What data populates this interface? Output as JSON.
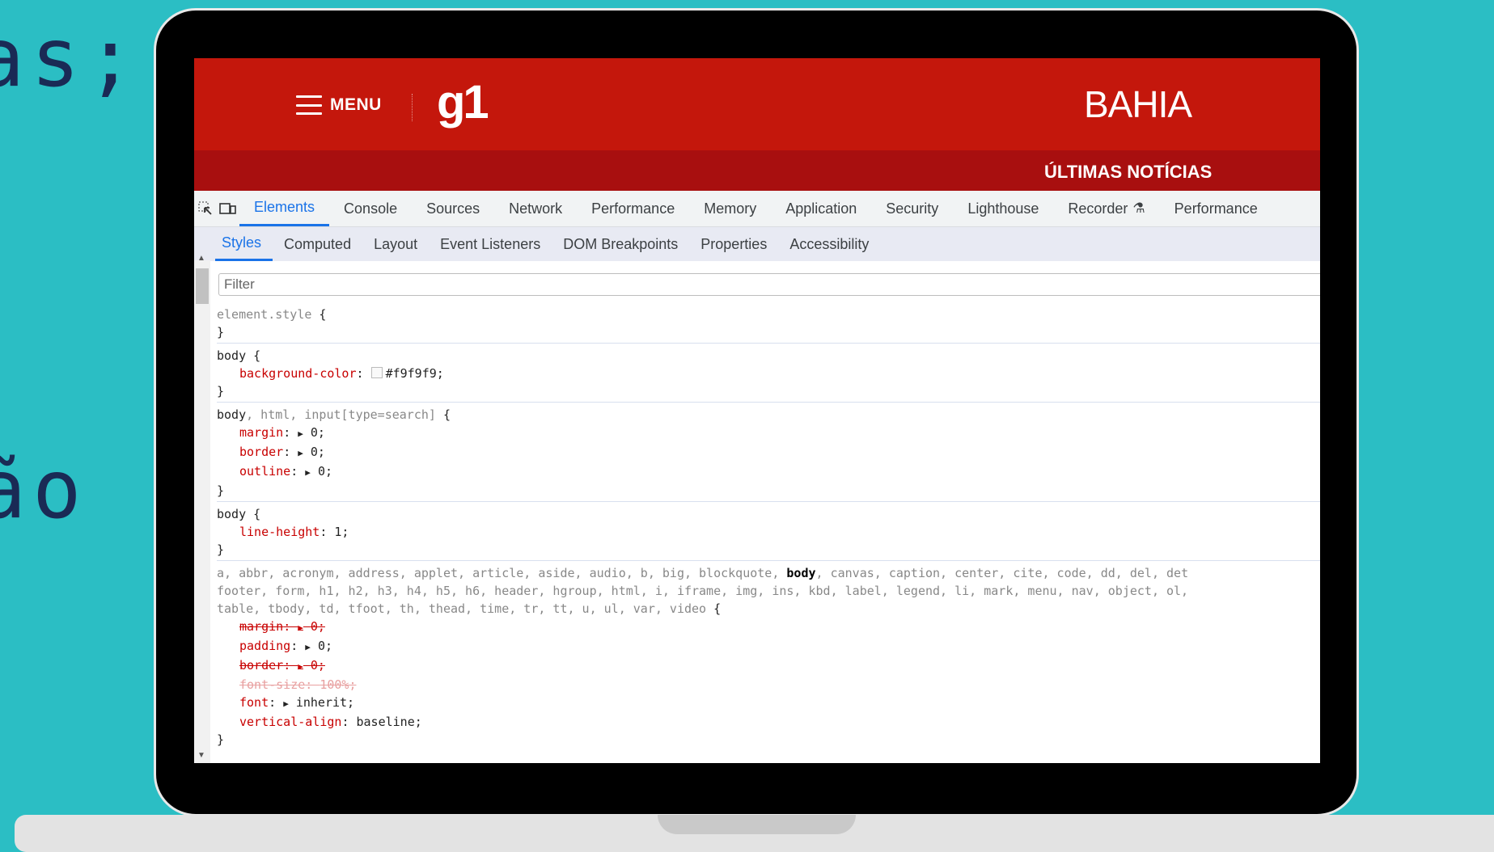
{
  "background": {
    "text_line1": "as;",
    "text_line2": "ão"
  },
  "g1": {
    "menu_label": "MENU",
    "logo": "g1",
    "region": "BAHIA",
    "sub_link": "ÚLTIMAS NOTÍCIAS",
    "brand_color": "#c4170c"
  },
  "devtools": {
    "tabs": [
      "Elements",
      "Console",
      "Sources",
      "Network",
      "Performance",
      "Memory",
      "Application",
      "Security",
      "Lighthouse",
      "Recorder",
      "Performance"
    ],
    "subtabs": [
      "Styles",
      "Computed",
      "Layout",
      "Event Listeners",
      "DOM Breakpoints",
      "Properties",
      "Accessibility"
    ],
    "filter_placeholder": "Filter",
    "rules": {
      "r1_selector": "element.style",
      "r2_selector": "body",
      "r2_prop": "background-color",
      "r2_value": "#f9f9f9;",
      "r3_sel_main": "body",
      "r3_sel_rest": ", html, input[type=search]",
      "r3_p1": "margin",
      "r3_v1": "0;",
      "r3_p2": "border",
      "r3_v2": "0;",
      "r3_p3": "outline",
      "r3_v3": "0;",
      "r4_selector": "body",
      "r4_prop": "line-height",
      "r4_value": "1;",
      "r5_line1a": "a, abbr, acronym, address, applet, article, aside, audio, b, big, blockquote, ",
      "r5_line1b": "body",
      "r5_line1c": ", canvas, caption, center, cite, code, dd, del, det",
      "r5_line2": "footer, form, h1, h2, h3, h4, h5, h6, header, hgroup, html, i, iframe, img, ins, kbd, label, legend, li, mark, menu, nav, object, ol,",
      "r5_line3": "table, tbody, td, tfoot, th, thead, time, tr, tt, u, ul, var, video",
      "r5_p1": "margin",
      "r5_v1": "0;",
      "r5_p2": "padding",
      "r5_v2": "0;",
      "r5_p3": "border",
      "r5_v3": "0;",
      "r5_p4": "font-size",
      "r5_v4": "100%;",
      "r5_p5": "font",
      "r5_v5": "inherit;",
      "r5_p6": "vertical-align",
      "r5_v6": "baseline;"
    }
  }
}
